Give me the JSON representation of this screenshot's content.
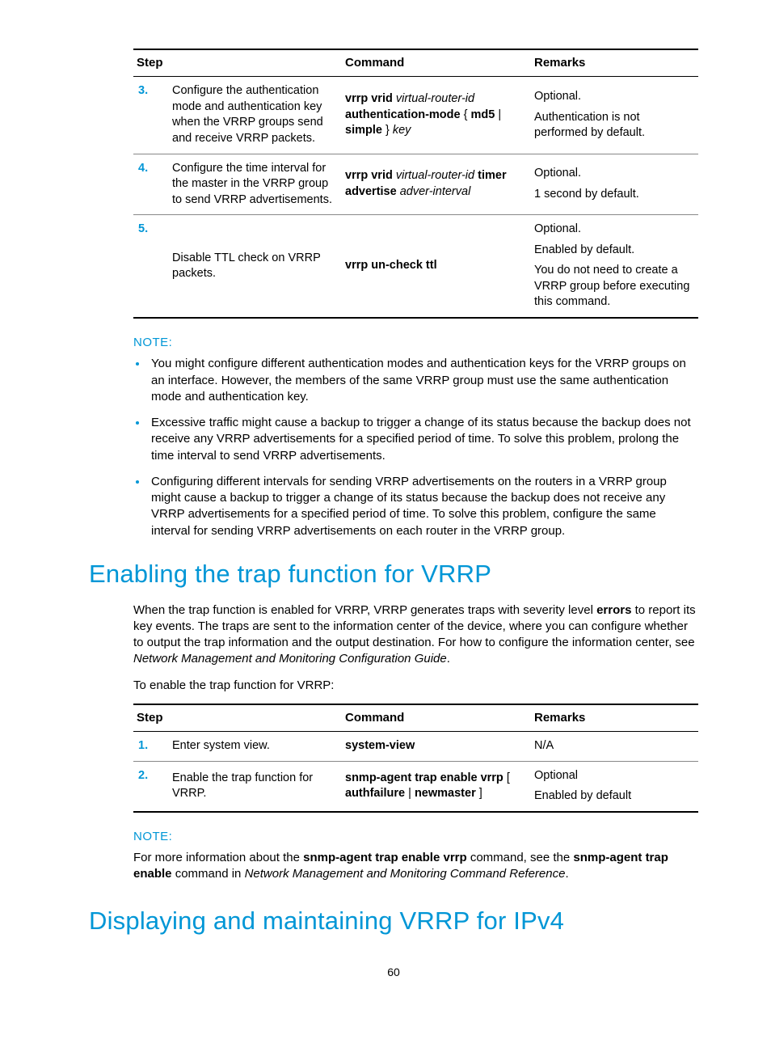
{
  "table1": {
    "headers": {
      "step": "Step",
      "command": "Command",
      "remarks": "Remarks"
    },
    "rows": [
      {
        "num": "3.",
        "desc": "Configure the authentication mode and authentication key when the VRRP groups send and receive VRRP packets.",
        "cmd_parts": [
          "vrrp vrid ",
          "virtual-router-id",
          " authentication-mode ",
          "{ ",
          "md5",
          " | ",
          "simple",
          " } ",
          "key"
        ],
        "cmd_types": [
          "b",
          "i",
          "b",
          "n",
          "b",
          "n",
          "b",
          "n",
          "i"
        ],
        "remarks_lines": [
          "Optional.",
          "Authentication is not performed by default."
        ]
      },
      {
        "num": "4.",
        "desc": "Configure the time interval for the master in the VRRP group to send VRRP advertisements.",
        "cmd_parts": [
          "vrrp vrid ",
          "virtual-router-id",
          " timer advertise ",
          "adver-interval"
        ],
        "cmd_types": [
          "b",
          "i",
          "b",
          "i"
        ],
        "remarks_lines": [
          "Optional.",
          "1 second by default."
        ]
      },
      {
        "num": "5.",
        "desc": "Disable TTL check on VRRP packets.",
        "cmd_parts": [
          "vrrp un-check ttl"
        ],
        "cmd_types": [
          "b"
        ],
        "remarks_lines": [
          "Optional.",
          "Enabled by default.",
          "You do not need to create a VRRP group before executing this command."
        ]
      }
    ]
  },
  "note1": {
    "label": "NOTE:",
    "items": [
      "You might configure different authentication modes and authentication keys for the VRRP groups on an interface. However, the members of the same VRRP group must use the same authentication mode and authentication key.",
      "Excessive traffic might cause a backup to trigger a change of its status because the backup does not receive any VRRP advertisements for a specified period of time. To solve this problem, prolong the time interval to send VRRP advertisements.",
      "Configuring different intervals for sending VRRP advertisements on the routers in a VRRP group might cause a backup to trigger a change of its status because the backup does not receive any VRRP advertisements for a specified period of time. To solve this problem, configure the same interval for sending VRRP advertisements on each router in the VRRP group."
    ]
  },
  "section1": {
    "title": "Enabling the trap function for VRRP",
    "para_parts": [
      "When the trap function is enabled for VRRP, VRRP generates traps with severity level ",
      "errors",
      " to report its key events. The traps are sent to the information center of the device, where you can configure whether to output the trap information and the output destination. For how to configure the information center, see ",
      "Network Management and Monitoring Configuration Guide",
      "."
    ],
    "para_types": [
      "n",
      "b",
      "n",
      "i",
      "n"
    ],
    "intro2": "To enable the trap function for VRRP:"
  },
  "table2": {
    "headers": {
      "step": "Step",
      "command": "Command",
      "remarks": "Remarks"
    },
    "rows": [
      {
        "num": "1.",
        "desc": "Enter system view.",
        "cmd_parts": [
          "system-view"
        ],
        "cmd_types": [
          "b"
        ],
        "remarks_lines": [
          "N/A"
        ]
      },
      {
        "num": "2.",
        "desc": "Enable the trap function for VRRP.",
        "cmd_parts": [
          "snmp-agent trap enable vrrp ",
          "[ ",
          "authfailure",
          " | ",
          "newmaster",
          " ]"
        ],
        "cmd_types": [
          "b",
          "n",
          "b",
          "n",
          "b",
          "n"
        ],
        "remarks_lines": [
          "Optional",
          "Enabled by default"
        ]
      }
    ]
  },
  "note2": {
    "label": "NOTE:",
    "para_parts": [
      "For more information about the ",
      "snmp-agent trap enable vrrp",
      " command, see the ",
      "snmp-agent trap enable",
      " command in ",
      "Network Management and Monitoring Command Reference",
      "."
    ],
    "para_types": [
      "n",
      "b",
      "n",
      "b",
      "n",
      "i",
      "n"
    ]
  },
  "section2": {
    "title": "Displaying and maintaining VRRP for IPv4"
  },
  "page_number": "60"
}
